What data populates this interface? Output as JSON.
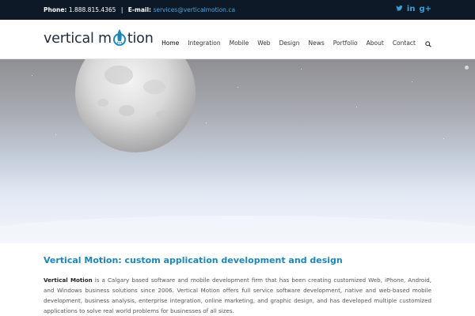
{
  "topbar": {
    "phone_label": "Phone:",
    "phone_value": "1.888.815.4365",
    "separator": "|",
    "email_label": "E-mail:",
    "email_value": "services@verticalmotion.ca",
    "social_icons": [
      "twitter-icon",
      "linkedin-icon",
      "google-plus-icon"
    ],
    "social_glyphs": {
      "twitter": "🐦",
      "linkedin": "in",
      "google": "g+"
    }
  },
  "header": {
    "logo_text_1": "vertical m",
    "logo_text_2": "tion",
    "nav": [
      "Home",
      "Integration",
      "Mobile",
      "Web",
      "Design",
      "News",
      "Portfolio",
      "About",
      "Contact"
    ],
    "active_nav": "Home"
  },
  "colors": {
    "topbar_bg": "#0e1927",
    "accent": "#1b86b8",
    "link": "#4aa3d8"
  },
  "main": {
    "heading": "Vertical Motion: custom application development and design",
    "intro_bold": "Vertical Motion",
    "intro_text": " is a Calgary based software and mobile development firm that has been creating customized Web, iPhone, Android, and Windows business solutions since 2006. Vertical Motion offers full service software development, native and web-based mobile development, business analysis, enterprise integration, online marketing, and graphic design, and has developed multiple customized applications to solve real world problems for businesses of all sizes."
  }
}
